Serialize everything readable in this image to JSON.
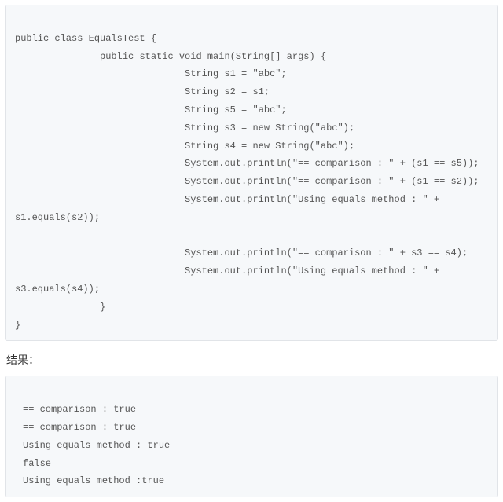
{
  "code": {
    "lines": [
      "public class EqualsTest {",
      "               public static void main(String[] args) {",
      "                              String s1 = \"abc\";",
      "                              String s2 = s1;",
      "                              String s5 = \"abc\";",
      "                              String s3 = new String(\"abc\");",
      "                              String s4 = new String(\"abc\");",
      "                              System.out.println(\"== comparison : \" + (s1 == s5));",
      "                              System.out.println(\"== comparison : \" + (s1 == s2));",
      "                              System.out.println(\"Using equals method : \" + s1.equals(s2));",
      "",
      "                              System.out.println(\"== comparison : \" + s3 == s4);",
      "                              System.out.println(\"Using equals method : \" + s3.equals(s4));",
      "               }",
      "}"
    ]
  },
  "result_label": "结果：",
  "output": {
    "lines": [
      "== comparison : true",
      "== comparison : true",
      "Using equals method : true",
      "false",
      "Using equals method :true"
    ]
  }
}
